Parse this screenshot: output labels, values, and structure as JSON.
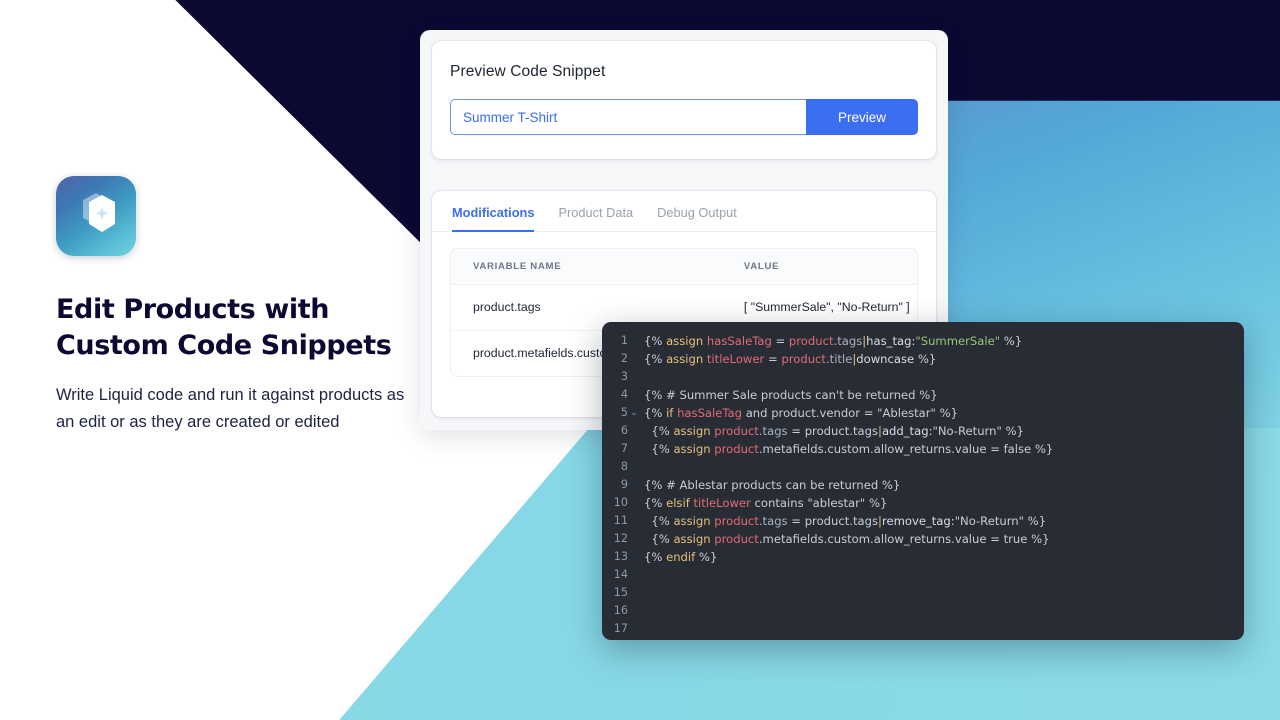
{
  "hero": {
    "logo_icon": "hexagon-sparkle-logo",
    "title_line1": "Edit Products with",
    "title_line2": "Custom Code Snippets",
    "subtitle": "Write Liquid code and run it against products as an edit or as they are created or edited"
  },
  "preview_card": {
    "title": "Preview Code Snippet",
    "input_value": "Summer T-Shirt",
    "input_placeholder": "Summer T-Shirt",
    "button_label": "Preview"
  },
  "results_card": {
    "tabs": [
      {
        "label": "Modifications",
        "active": true
      },
      {
        "label": "Product Data",
        "active": false
      },
      {
        "label": "Debug Output",
        "active": false
      }
    ],
    "columns": [
      "VARIABLE NAME",
      "VALUE"
    ],
    "rows": [
      {
        "name": "product.tags",
        "value": "[ \"SummerSale\", \"No-Return\" ]"
      },
      {
        "name": "product.metafields.custom.allow_returns.value",
        "value": ""
      }
    ]
  },
  "code_editor": {
    "lines": [
      {
        "n": "1",
        "fold": "",
        "tokens": [
          {
            "t": "{% ",
            "c": "t-punc"
          },
          {
            "t": "assign ",
            "c": "t-kw"
          },
          {
            "t": "hasSaleTag",
            "c": "t-var"
          },
          {
            "t": " = ",
            "c": "t-plain"
          },
          {
            "t": "product",
            "c": "t-var"
          },
          {
            "t": ".tags",
            "c": "t-prop"
          },
          {
            "t": "|",
            "c": "t-kw"
          },
          {
            "t": "has_tag:",
            "c": "t-filter"
          },
          {
            "t": "\"SummerSale\"",
            "c": "t-str"
          },
          {
            "t": " %}",
            "c": "t-punc"
          }
        ]
      },
      {
        "n": "2",
        "fold": "",
        "tokens": [
          {
            "t": "{% ",
            "c": "t-punc"
          },
          {
            "t": "assign ",
            "c": "t-kw"
          },
          {
            "t": "titleLower",
            "c": "t-var"
          },
          {
            "t": " = ",
            "c": "t-plain"
          },
          {
            "t": "product",
            "c": "t-var"
          },
          {
            "t": ".title",
            "c": "t-prop"
          },
          {
            "t": "|",
            "c": "t-kw"
          },
          {
            "t": "downcase",
            "c": "t-filter"
          },
          {
            "t": " %}",
            "c": "t-punc"
          }
        ]
      },
      {
        "n": "3",
        "fold": "",
        "tokens": []
      },
      {
        "n": "4",
        "fold": "",
        "tokens": [
          {
            "t": "{% # Summer Sale products can't be returned %}",
            "c": "t-comment"
          }
        ]
      },
      {
        "n": "5",
        "fold": "⌄",
        "tokens": [
          {
            "t": "{% ",
            "c": "t-punc"
          },
          {
            "t": "if ",
            "c": "t-kw"
          },
          {
            "t": "hasSaleTag",
            "c": "t-var"
          },
          {
            "t": " and product.vendor = \"Ablestar\" %}",
            "c": "t-plain"
          }
        ]
      },
      {
        "n": "6",
        "fold": "",
        "tokens": [
          {
            "t": "  {% ",
            "c": "t-punc"
          },
          {
            "t": "assign ",
            "c": "t-kw"
          },
          {
            "t": "product",
            "c": "t-var"
          },
          {
            "t": ".tags",
            "c": "t-prop"
          },
          {
            "t": " = product.tags",
            "c": "t-plain"
          },
          {
            "t": "|",
            "c": "t-kw"
          },
          {
            "t": "add_tag:",
            "c": "t-filter"
          },
          {
            "t": "\"No-Return\" %}",
            "c": "t-plain"
          }
        ]
      },
      {
        "n": "7",
        "fold": "",
        "tokens": [
          {
            "t": "  {% ",
            "c": "t-punc"
          },
          {
            "t": "assign ",
            "c": "t-kw"
          },
          {
            "t": "product",
            "c": "t-var"
          },
          {
            "t": ".metafields.custom.allow_returns.value = false %}",
            "c": "t-plain"
          }
        ]
      },
      {
        "n": "8",
        "fold": "",
        "tokens": []
      },
      {
        "n": "9",
        "fold": "",
        "tokens": [
          {
            "t": "{% # Ablestar products can be returned %}",
            "c": "t-comment"
          }
        ]
      },
      {
        "n": "10",
        "fold": "",
        "tokens": [
          {
            "t": "{% ",
            "c": "t-punc"
          },
          {
            "t": "elsif ",
            "c": "t-kw"
          },
          {
            "t": "titleLower",
            "c": "t-var"
          },
          {
            "t": " contains \"ablestar\" %}",
            "c": "t-plain"
          }
        ]
      },
      {
        "n": "11",
        "fold": "",
        "tokens": [
          {
            "t": "  {% ",
            "c": "t-punc"
          },
          {
            "t": "assign ",
            "c": "t-kw"
          },
          {
            "t": "product",
            "c": "t-var"
          },
          {
            "t": ".tags",
            "c": "t-prop"
          },
          {
            "t": " = product.tags",
            "c": "t-plain"
          },
          {
            "t": "|",
            "c": "t-kw"
          },
          {
            "t": "remove_tag:",
            "c": "t-filter"
          },
          {
            "t": "\"No-Return\" %}",
            "c": "t-plain"
          }
        ]
      },
      {
        "n": "12",
        "fold": "",
        "tokens": [
          {
            "t": "  {% ",
            "c": "t-punc"
          },
          {
            "t": "assign ",
            "c": "t-kw"
          },
          {
            "t": "product",
            "c": "t-var"
          },
          {
            "t": ".metafields.custom.allow_returns.value = true %}",
            "c": "t-plain"
          }
        ]
      },
      {
        "n": "13",
        "fold": "",
        "tokens": [
          {
            "t": "{% ",
            "c": "t-punc"
          },
          {
            "t": "endif ",
            "c": "t-kw"
          },
          {
            "t": "%}",
            "c": "t-punc"
          }
        ]
      },
      {
        "n": "14",
        "fold": "",
        "tokens": []
      },
      {
        "n": "15",
        "fold": "",
        "tokens": []
      },
      {
        "n": "16",
        "fold": "",
        "tokens": []
      },
      {
        "n": "17",
        "fold": "",
        "tokens": []
      }
    ]
  },
  "colors": {
    "accent_blue": "#3b6ef0",
    "navy": "#0b0832",
    "teal": "#8adbe6",
    "editor_bg": "#282c34"
  }
}
